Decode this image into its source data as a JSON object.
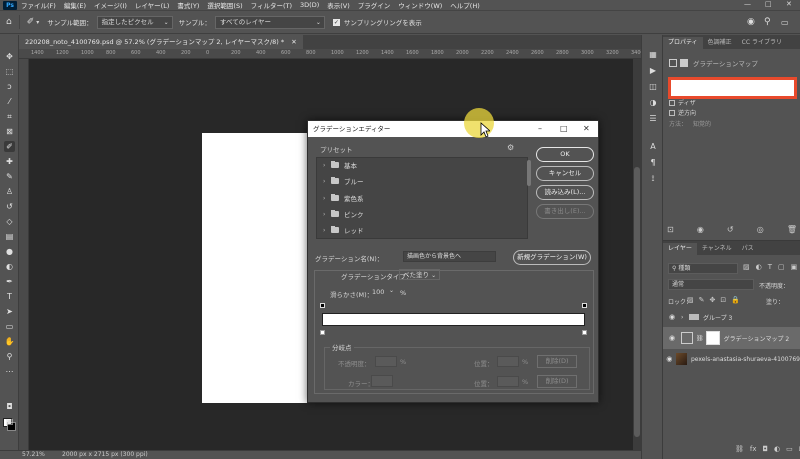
{
  "menubar": {
    "logo": "Ps",
    "items": [
      "ファイル(F)",
      "編集(E)",
      "イメージ(I)",
      "レイヤー(L)",
      "書式(Y)",
      "選択範囲(S)",
      "フィルター(T)",
      "3D(D)",
      "表示(V)",
      "プラグイン",
      "ウィンドウ(W)",
      "ヘルプ(H)"
    ],
    "window_controls": [
      "—",
      "□",
      "✕"
    ]
  },
  "options": {
    "sample_size_label": "サンプル範囲：",
    "sample_size_value": "指定したピクセル",
    "sample_label": "サンプル：",
    "sample_value": "すべてのレイヤー",
    "show_ring_label": "サンプリングリングを表示"
  },
  "document": {
    "tab_title": "220208_noto_4100769.psd @ 57.2% (グラデーションマップ 2, レイヤーマスク/8) *",
    "ruler_ticks": [
      "1400",
      "1200",
      "1000",
      "800",
      "600",
      "400",
      "200",
      "0",
      "200",
      "400",
      "600",
      "800",
      "1000",
      "1200",
      "1400",
      "1600",
      "1800",
      "2000",
      "2200",
      "2400",
      "2600",
      "2800",
      "3000",
      "3200",
      "3400"
    ]
  },
  "status": {
    "zoom": "57.21%",
    "doc_size": "2000 px x 2715 px (300 ppi)"
  },
  "properties": {
    "tabs": [
      "プロパティ",
      "色調補正",
      "CC ライブラリ"
    ],
    "header": "グラデーションマップ",
    "dither_label": "ディザ",
    "reverse_label": "逆方向",
    "method_label": "方法：",
    "method_value": "知覚的"
  },
  "layers": {
    "tabs": [
      "レイヤー",
      "チャンネル",
      "パス"
    ],
    "filter_kind": "種類",
    "blend_mode": "通常",
    "opacity_label": "不透明度：",
    "lock_label": "ロック：",
    "fill_label": "塗り：",
    "items": [
      {
        "name": "グループ 3"
      },
      {
        "name": "グラデーションマップ 2"
      },
      {
        "name": "pexels-anastasia-shuraeva-4100769"
      }
    ]
  },
  "dialog": {
    "title": "グラデーションエディター",
    "presets_label": "プリセット",
    "presets": [
      "基本",
      "ブルー",
      "紫色系",
      "ピンク",
      "レッド"
    ],
    "btn_ok": "OK",
    "btn_cancel": "キャンセル",
    "btn_load": "読み込み(L)...",
    "btn_save": "書き出し(E)...",
    "name_label": "グラデーション名(N)：",
    "name_value": "描画色から背景色へ",
    "btn_new": "新規グラデーション(W)",
    "type_label": "グラデーションタイプ：",
    "type_value": "べた塗り",
    "smooth_label": "滑らかさ(M)：",
    "smooth_value": "100",
    "smooth_unit": "%",
    "stops_label": "分岐点",
    "opacity_label": "不透明度：",
    "location_label": "位置：",
    "delete_label": "削除(D)",
    "color_label": "カラー：",
    "pct": "%"
  }
}
